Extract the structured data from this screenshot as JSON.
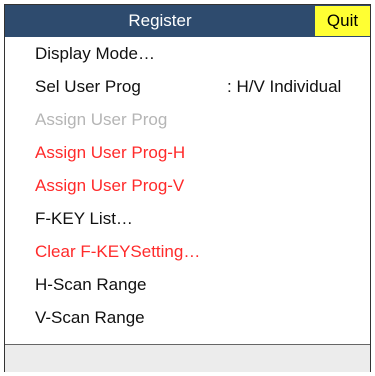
{
  "menu": {
    "title": "Register",
    "quit_label": "Quit",
    "items": [
      {
        "label": "Display Mode…",
        "value": "",
        "state": "normal"
      },
      {
        "label": "Sel User Prog",
        "value": ": H/V Individual",
        "state": "normal"
      },
      {
        "label": "Assign User Prog",
        "value": "",
        "state": "disabled"
      },
      {
        "label": "Assign User Prog-H",
        "value": "",
        "state": "red"
      },
      {
        "label": "Assign User Prog-V",
        "value": "",
        "state": "red"
      },
      {
        "label": "F-KEY List…",
        "value": "",
        "state": "normal"
      },
      {
        "label": "Clear F-KEYSetting…",
        "value": "",
        "state": "red"
      },
      {
        "label": "H-Scan Range",
        "value": "",
        "state": "normal"
      },
      {
        "label": "V-Scan Range",
        "value": "",
        "state": "normal"
      }
    ]
  },
  "colors": {
    "title_bar": "#2e4b6e",
    "quit_button": "#ffff33",
    "red_item": "#ff2a2a",
    "disabled_item": "#b5b5b5"
  }
}
